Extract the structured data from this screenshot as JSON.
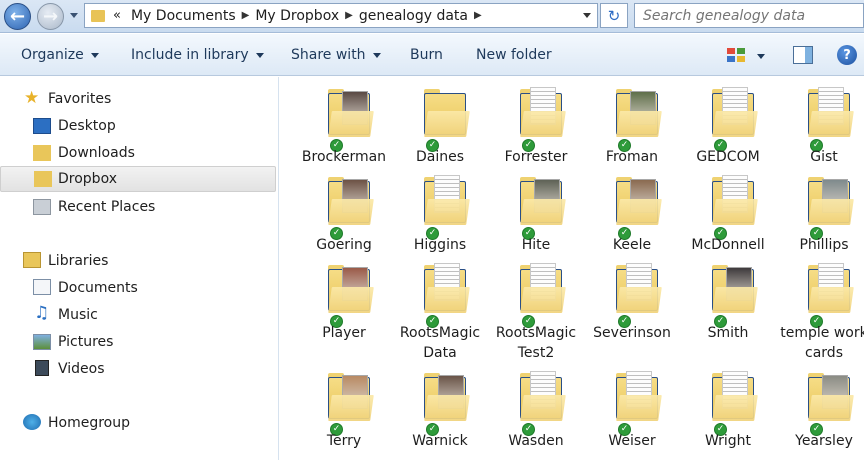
{
  "address": {
    "breadcrumbs": [
      "My Documents",
      "My Dropbox",
      "genealogy data"
    ],
    "overflow_glyph": "«",
    "search_placeholder": "Search genealogy data"
  },
  "toolbar": {
    "organize": "Organize",
    "include_in_library": "Include in library",
    "share_with": "Share with",
    "burn": "Burn",
    "new_folder": "New folder",
    "help": "?"
  },
  "nav": {
    "favorites": "Favorites",
    "desktop": "Desktop",
    "downloads": "Downloads",
    "dropbox": "Dropbox",
    "recent_places": "Recent Places",
    "libraries": "Libraries",
    "documents": "Documents",
    "music": "Music",
    "pictures": "Pictures",
    "videos": "Videos",
    "homegroup": "Homegroup"
  },
  "folders": [
    {
      "name": "Brockerman",
      "kind": "photo",
      "color": "#5a4a44"
    },
    {
      "name": "Daines",
      "kind": "plain",
      "color": ""
    },
    {
      "name": "Forrester",
      "kind": "doc",
      "color": ""
    },
    {
      "name": "Froman",
      "kind": "photo",
      "color": "#5f6f4a"
    },
    {
      "name": "GEDCOM",
      "kind": "doc",
      "color": ""
    },
    {
      "name": "Gist",
      "kind": "doc",
      "color": ""
    },
    {
      "name": "Goering",
      "kind": "photo",
      "color": "#6d5245"
    },
    {
      "name": "Higgins",
      "kind": "doc",
      "color": ""
    },
    {
      "name": "Hite",
      "kind": "photo",
      "color": "#5e6256"
    },
    {
      "name": "Keele",
      "kind": "photo",
      "color": "#8a6a50"
    },
    {
      "name": "McDonnell",
      "kind": "doc",
      "color": ""
    },
    {
      "name": "Phillips",
      "kind": "photo",
      "color": "#7f8a8c"
    },
    {
      "name": "Player",
      "kind": "photo",
      "color": "#9a5a48"
    },
    {
      "name": "RootsMagic Data",
      "kind": "doc",
      "color": ""
    },
    {
      "name": "RootsMagic Test2",
      "kind": "doc",
      "color": ""
    },
    {
      "name": "Severinson",
      "kind": "doc",
      "color": ""
    },
    {
      "name": "Smith",
      "kind": "photo",
      "color": "#3e3a3c"
    },
    {
      "name": "temple work cards",
      "kind": "doc",
      "color": ""
    },
    {
      "name": "Terry",
      "kind": "photo",
      "color": "#b88a63"
    },
    {
      "name": "Warnick",
      "kind": "photo",
      "color": "#6a5448"
    },
    {
      "name": "Wasden",
      "kind": "doc",
      "color": ""
    },
    {
      "name": "Weiser",
      "kind": "doc",
      "color": ""
    },
    {
      "name": "Wright",
      "kind": "doc",
      "color": ""
    },
    {
      "name": "Yearsley",
      "kind": "photo",
      "color": "#8b8c84"
    }
  ],
  "colors": {
    "accent": "#1e395b",
    "sync_check": "#2e9b3a",
    "folder": "#f0d27a"
  }
}
